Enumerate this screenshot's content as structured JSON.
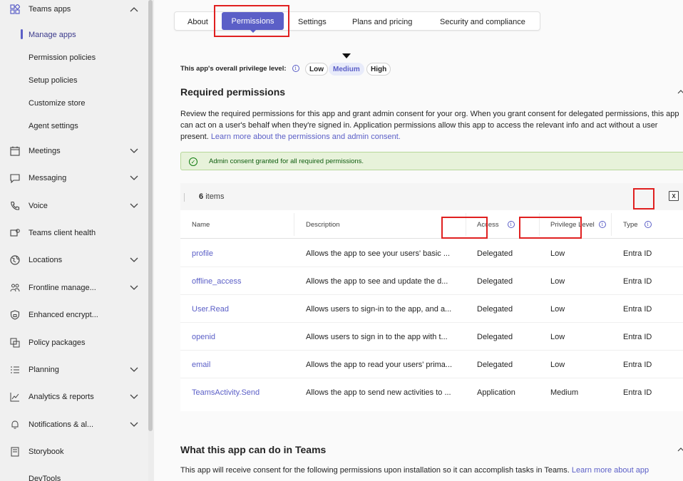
{
  "sidebar": {
    "items": [
      {
        "label": "Teams apps",
        "icon": "apps-icon",
        "chevron": "up"
      },
      {
        "label": "Meetings",
        "icon": "calendar-icon",
        "chevron": "down"
      },
      {
        "label": "Messaging",
        "icon": "chat-icon",
        "chevron": "down"
      },
      {
        "label": "Voice",
        "icon": "phone-icon",
        "chevron": "down"
      },
      {
        "label": "Teams client health",
        "icon": "health-icon",
        "chevron": ""
      },
      {
        "label": "Locations",
        "icon": "globe-icon",
        "chevron": "down"
      },
      {
        "label": "Frontline manage...",
        "icon": "people-icon",
        "chevron": "down"
      },
      {
        "label": "Enhanced encrypt...",
        "icon": "shield-lock-icon",
        "chevron": ""
      },
      {
        "label": "Policy packages",
        "icon": "package-icon",
        "chevron": ""
      },
      {
        "label": "Planning",
        "icon": "list-icon",
        "chevron": "down"
      },
      {
        "label": "Analytics & reports",
        "icon": "chart-icon",
        "chevron": "down"
      },
      {
        "label": "Notifications & al...",
        "icon": "bell-icon",
        "chevron": "down"
      },
      {
        "label": "Storybook",
        "icon": "book-icon",
        "chevron": ""
      },
      {
        "label": "DevTools",
        "icon": "",
        "chevron": ""
      }
    ],
    "subitems": [
      {
        "label": "Manage apps",
        "active": true
      },
      {
        "label": "Permission policies"
      },
      {
        "label": "Setup policies"
      },
      {
        "label": "Customize store"
      },
      {
        "label": "Agent settings"
      }
    ]
  },
  "tabs": [
    "About",
    "Permissions",
    "Settings",
    "Plans and pricing",
    "Security and compliance"
  ],
  "privilege": {
    "label": "This app's overall privilege level:",
    "levels": [
      "Low",
      "Medium",
      "High"
    ],
    "selected": "Medium"
  },
  "required": {
    "title": "Required permissions",
    "description": "Review the required permissions for this app and grant admin consent for your org. When you grant consent for delegated permissions, this app can act on a user's behalf when they're signed in. Application permissions allow this app to access the relevant info and act without a user present.",
    "link": "Learn more about the permissions and admin consent.",
    "consent_message": "Admin consent granted for all required permissions.",
    "item_count": "6",
    "item_count_suffix": "items"
  },
  "table": {
    "headers": [
      "Name",
      "Description",
      "Access",
      "Privilege Level",
      "Type"
    ],
    "rows": [
      {
        "name": "profile",
        "description": "Allows the app to see your users' basic ...",
        "access": "Delegated",
        "level": "Low",
        "type": "Entra ID"
      },
      {
        "name": "offline_access",
        "description": "Allows the app to see and update the d...",
        "access": "Delegated",
        "level": "Low",
        "type": "Entra ID"
      },
      {
        "name": "User.Read",
        "description": "Allows users to sign-in to the app, and a...",
        "access": "Delegated",
        "level": "Low",
        "type": "Entra ID"
      },
      {
        "name": "openid",
        "description": "Allows users to sign in to the app with t...",
        "access": "Delegated",
        "level": "Low",
        "type": "Entra ID"
      },
      {
        "name": "email",
        "description": "Allows the app to read your users' prima...",
        "access": "Delegated",
        "level": "Low",
        "type": "Entra ID"
      },
      {
        "name": "TeamsActivity.Send",
        "description": "Allows the app to send new activities to ...",
        "access": "Application",
        "level": "Medium",
        "type": "Entra ID"
      }
    ]
  },
  "teams_section": {
    "title": "What this app can do in Teams",
    "description": "This app will receive consent for the following permissions upon installation so it can accomplish tasks in Teams.",
    "link": "Learn more about app"
  },
  "colors": {
    "accent": "#5b5fc7",
    "highlight": "#e02020",
    "success_bg": "#e7f2da"
  }
}
